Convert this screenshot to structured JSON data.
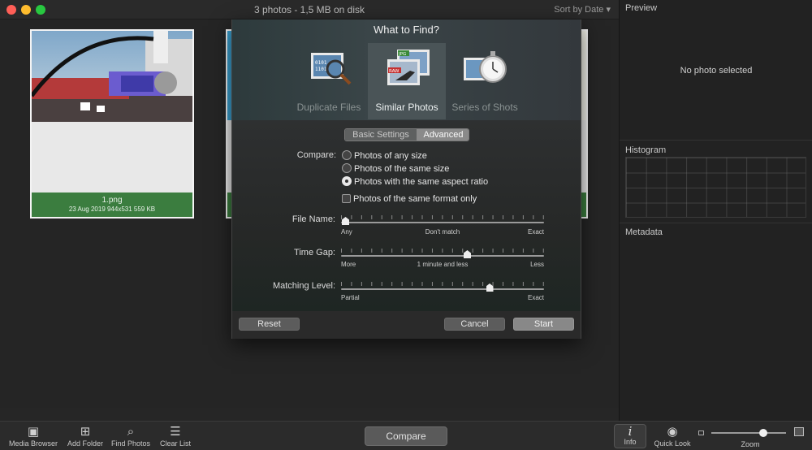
{
  "window": {
    "title": "3 photos - 1,5 MB on disk",
    "sort_label": "Sort by Date"
  },
  "traffic_lights": {
    "close": "#ff5f57",
    "minimize": "#febc2e",
    "zoom": "#28c840"
  },
  "photos": [
    {
      "name": "1.png",
      "meta": "23 Aug 2019  944x531  559 KB"
    }
  ],
  "accent_colors": {
    "selected_caption": "#3b7d3f"
  },
  "right_panel": {
    "preview_title": "Preview",
    "no_photo": "No photo selected",
    "histogram_title": "Histogram",
    "metadata_title": "Metadata"
  },
  "dialog": {
    "title": "What to Find?",
    "modes": [
      {
        "label": "Duplicate Files",
        "icon": "magnifier-binary-photo-icon",
        "selected": false
      },
      {
        "label": "Similar Photos",
        "icon": "jpg-raw-photos-icon",
        "selected": true
      },
      {
        "label": "Series of Shots",
        "icon": "stopwatch-photos-icon",
        "selected": false
      }
    ],
    "tabs": {
      "basic": "Basic Settings",
      "advanced": "Advanced",
      "active": "advanced"
    },
    "compare_label": "Compare:",
    "compare_options": [
      {
        "label": "Photos of any size",
        "checked": false
      },
      {
        "label": "Photos of the same size",
        "checked": false
      },
      {
        "label": "Photos with the same aspect ratio",
        "checked": true
      }
    ],
    "same_format_label": "Photos of the same format only",
    "same_format_checked": false,
    "sliders": [
      {
        "label": "File Name:",
        "left": "Any",
        "middle": "Don't match",
        "right": "Exact",
        "value": 0.02
      },
      {
        "label": "Time Gap:",
        "left": "More",
        "middle": "1 minute and less",
        "right": "Less",
        "value": 0.62
      },
      {
        "label": "Matching Level:",
        "left": "Partial",
        "middle": "",
        "right": "Exact",
        "value": 0.73
      }
    ],
    "buttons": {
      "reset": "Reset",
      "cancel": "Cancel",
      "start": "Start"
    }
  },
  "toolbar": {
    "media_browser": "Media Browser",
    "add_folder": "Add Folder",
    "find_photos": "Find Photos",
    "clear_list": "Clear List",
    "compare": "Compare",
    "info": "Info",
    "quick_look": "Quick Look",
    "zoom": "Zoom",
    "zoom_value": 0.7
  }
}
